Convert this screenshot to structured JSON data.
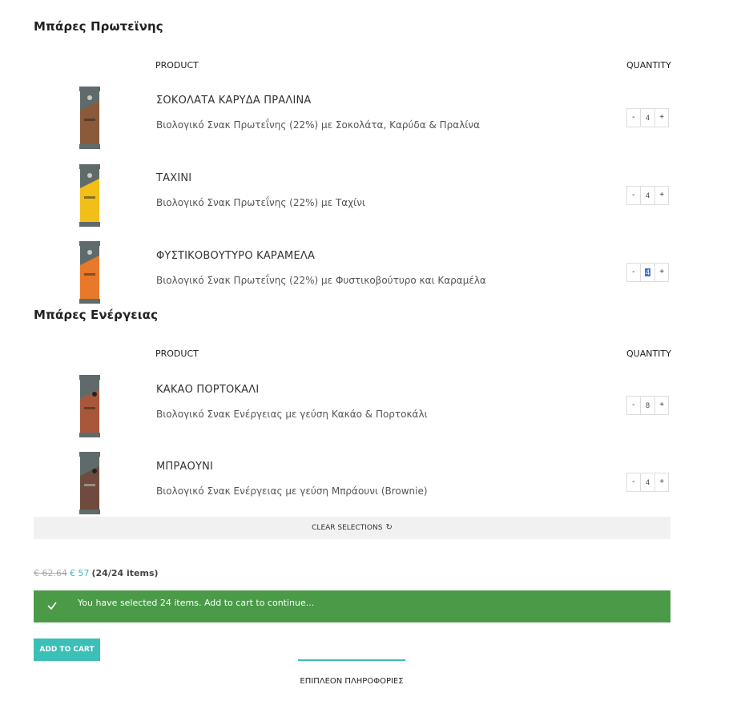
{
  "sections": [
    {
      "title": "Μπάρες Πρωτεϊνης",
      "columns": {
        "product": "PRODUCT",
        "quantity": "QUANTITY"
      },
      "items": [
        {
          "name": "ΣΟΚΟΛΑΤΑ ΚΑΡΥΔΑ ΠΡΑΛΙΝΑ",
          "desc": "Βιολογικό Σνακ Πρωτεΐνης (22%) με Σοκολάτα, Καρύδα & Πραλίνα",
          "qty": "4",
          "color": "#8a5a3a"
        },
        {
          "name": "ΤΑΧΙΝΙ",
          "desc": "Βιολογικό Σνακ Πρωτεΐνης (22%) με Ταχίνι",
          "qty": "4",
          "color": "#f1bf17"
        },
        {
          "name": "ΦΥΣΤΙΚΟΒΟΥΤΥΡΟ ΚΑΡΑΜΕΛΑ",
          "desc": "Βιολογικό Σνακ Πρωτεΐνης (22%) με Φυστικοβούτυρο και Καραμέλα",
          "qty": "4",
          "color": "#e8782a"
        }
      ]
    },
    {
      "title": "Μπάρες Ενέργειας",
      "columns": {
        "product": "PRODUCT",
        "quantity": "QUANTITY"
      },
      "items": [
        {
          "name": "ΚΑΚΑΟ ΠΟΡΤΟΚΑΛΙ",
          "desc": "Βιολογικό Σνακ Ενέργειας με γεύση Κακάο & Πορτοκάλι",
          "qty": "8",
          "color": "#a9573a"
        },
        {
          "name": "ΜΠΡΑΟΥΝΙ",
          "desc": "Βιολογικό Σνακ Ενέργειας με γεύση Μπράουνι (Brownie)",
          "qty": "4",
          "color": "#6e4b3c"
        }
      ]
    }
  ],
  "stepper": {
    "minus": "-",
    "plus": "+"
  },
  "clear_selections": "CLEAR SELECTIONS",
  "clear_icon": "↻",
  "price": {
    "old": "€ 62.64",
    "new": "€ 57",
    "count": "(24/24 items)"
  },
  "notice": {
    "message": "You have selected 24 items. Add to cart to continue..."
  },
  "add_to_cart": "ADD TO CART",
  "more_info_tab": "ΕΠΙΠΛΕΟΝ ΠΛΗΡΟΦΟΡΙΕΣ",
  "colors": {
    "accent": "#3bbfb6",
    "success": "#4a9a48",
    "wrapper": "#5f6b6b"
  }
}
